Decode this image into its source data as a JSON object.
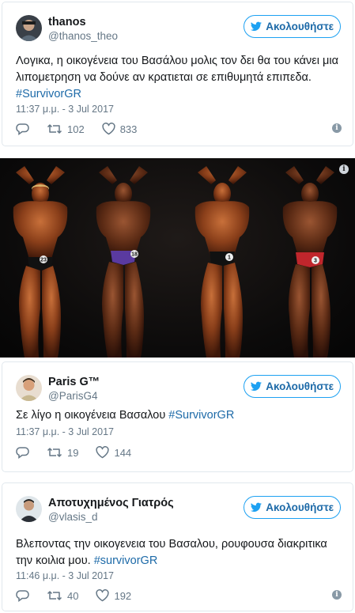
{
  "tweets": [
    {
      "name": "thanos",
      "handle": "@thanos_theo",
      "follow_label": "Ακολουθήστε",
      "text_line1": "Λογικα, η οικογένεια του Βασάλου μολις τον δει θα του κάνει μια",
      "text_line2": "λιπομετρηση να δούνε αν κρατιεται σε επιθυμητά επιπεδα.",
      "hashtag": "#SurvivorGR",
      "time": "11:37 μ.μ. - 3 Jul 2017",
      "retweets": "102",
      "likes": "833"
    },
    {
      "name": "Paris G™",
      "handle": "@ParisG4",
      "follow_label": "Ακολουθήστε",
      "text_prefix": "Σε λίγο η οικογένεια Βασαλου ",
      "hashtag": "#SurvivorGR",
      "time": "11:37 μ.μ. - 3 Jul 2017",
      "retweets": "19",
      "likes": "144"
    },
    {
      "name": "Αποτυχημένος Γιατρός",
      "handle": "@vlasis_d",
      "follow_label": "Ακολουθήστε",
      "text_line1": "Βλεποντας την οικογενεια του Βασαλου, ρουφουσα διακριτικα",
      "text_line2": "την κοιλια μου. ",
      "hashtag": "#survivorGR",
      "time": "11:46 μ.μ. - 3 Jul 2017",
      "retweets": "40",
      "likes": "192"
    }
  ],
  "photo": {
    "trunk_labels": [
      "23",
      "18",
      "1",
      "3"
    ]
  },
  "colors": {
    "twitter_blue": "#1da1f2",
    "link_blue": "#1d6aa8",
    "muted_gray": "#657786",
    "border": "#e1e8ed"
  },
  "icons": [
    "twitter-bird-icon",
    "reply-icon",
    "retweet-icon",
    "heart-icon",
    "info-icon"
  ]
}
